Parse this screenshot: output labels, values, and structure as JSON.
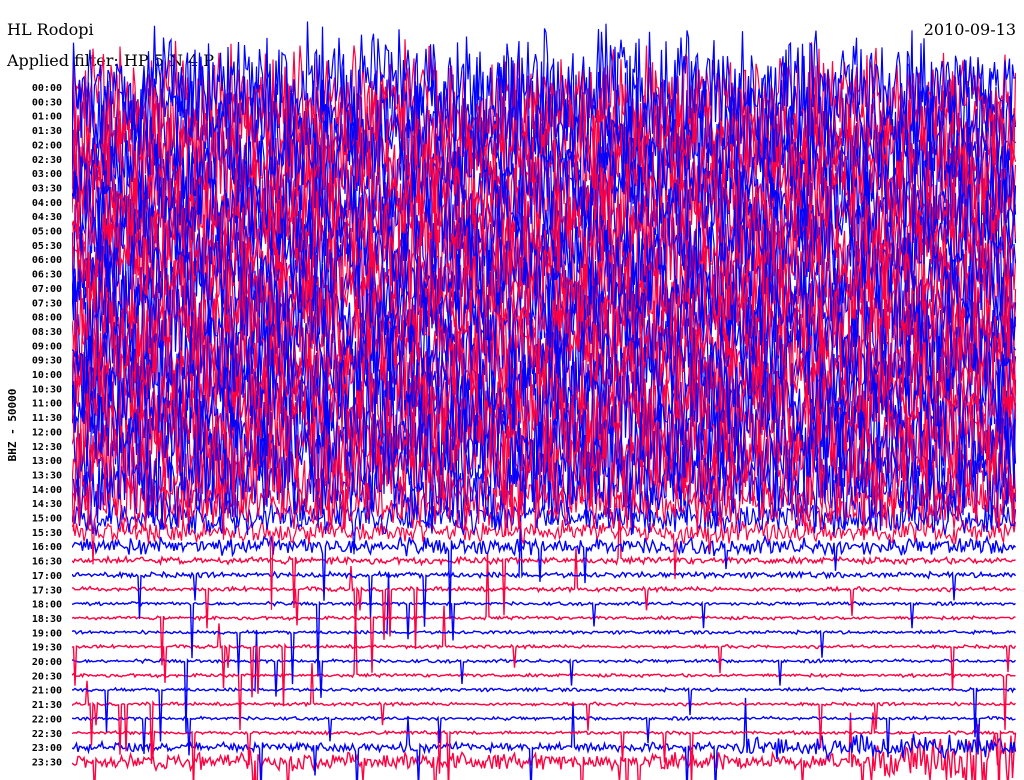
{
  "header": {
    "station": "HL Rodopi",
    "filter": "Applied filter: HP 5 N 4 P",
    "date": "2010-09-13"
  },
  "chart_data": {
    "type": "line",
    "title": "HL Rodopi",
    "subtitle": "Applied filter: HP 5 N 4 P",
    "date": "2010-09-13",
    "ylabel": "BHZ - 50000",
    "xlabel": "",
    "colors": [
      "#0000ff",
      "#ff0040"
    ],
    "row_labels": [
      "00:00",
      "00:30",
      "01:00",
      "01:30",
      "02:00",
      "02:30",
      "03:00",
      "03:30",
      "04:00",
      "04:30",
      "05:00",
      "05:30",
      "06:00",
      "06:30",
      "07:00",
      "07:30",
      "08:00",
      "08:30",
      "09:00",
      "09:30",
      "10:00",
      "10:30",
      "11:00",
      "11:30",
      "12:00",
      "12:30",
      "13:00",
      "13:30",
      "14:00",
      "14:30",
      "15:00",
      "15:30",
      "16:00",
      "16:30",
      "17:00",
      "17:30",
      "18:00",
      "18:30",
      "19:00",
      "19:30",
      "20:00",
      "20:30",
      "21:00",
      "21:30",
      "22:00",
      "22:30",
      "23:00",
      "23:30"
    ],
    "relative_amplitude": [
      1,
      1,
      1,
      1,
      1,
      1,
      1,
      1,
      1,
      1,
      1,
      1,
      1,
      1,
      1,
      1,
      1,
      1,
      1,
      1,
      1,
      1,
      1,
      1,
      1,
      1,
      1,
      1,
      0.7,
      0.45,
      0.3,
      0.2,
      0.15,
      0.06,
      0.05,
      0.04,
      0.03,
      0.03,
      0.03,
      0.03,
      0.03,
      0.03,
      0.03,
      0.03,
      0.03,
      0.03,
      0.08,
      0.15
    ]
  }
}
